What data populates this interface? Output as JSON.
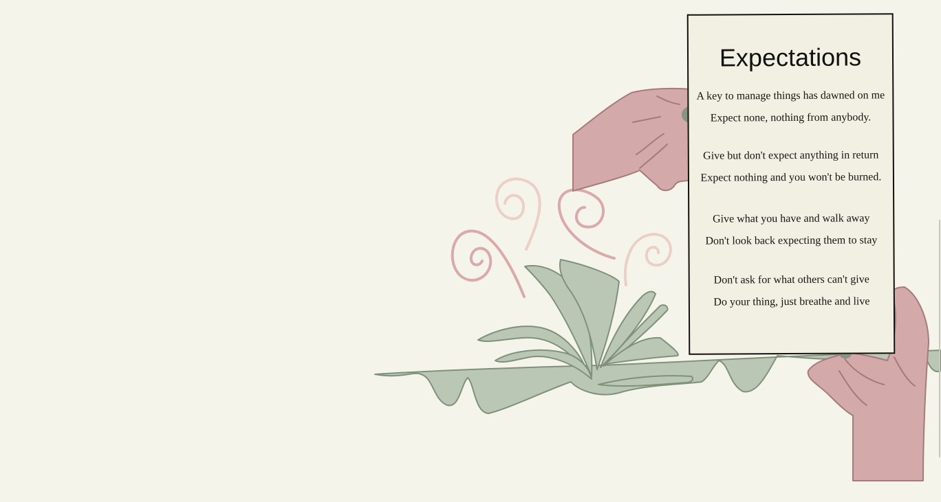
{
  "poem": {
    "title": "Expectations",
    "stanzas": [
      {
        "lines": [
          "A key to manage things has dawned on me",
          "Expect none, nothing from anybody."
        ]
      },
      {
        "lines": [
          "Give but don't expect anything in return",
          "Expect nothing and you won't be burned."
        ]
      },
      {
        "lines": [
          "Give what you have and walk away",
          "Don't look back expecting them to stay"
        ]
      },
      {
        "lines": [
          "Don't ask for what others can't give",
          "Do your thing, just breathe and live"
        ]
      }
    ]
  },
  "colors": {
    "background": "#f5f4ea",
    "card": "#f2f0e2",
    "skin": "#d4a9a9",
    "skin_outline": "#a67a7a",
    "nail": "#8a9480",
    "foliage": "#bac7b4",
    "foliage_outline": "#7f917a",
    "swirl_dark": "#d9aaa9",
    "swirl_light": "#eccfc7"
  },
  "icons": [
    "swirl-decoration",
    "leaf-cluster",
    "holding-hand"
  ]
}
